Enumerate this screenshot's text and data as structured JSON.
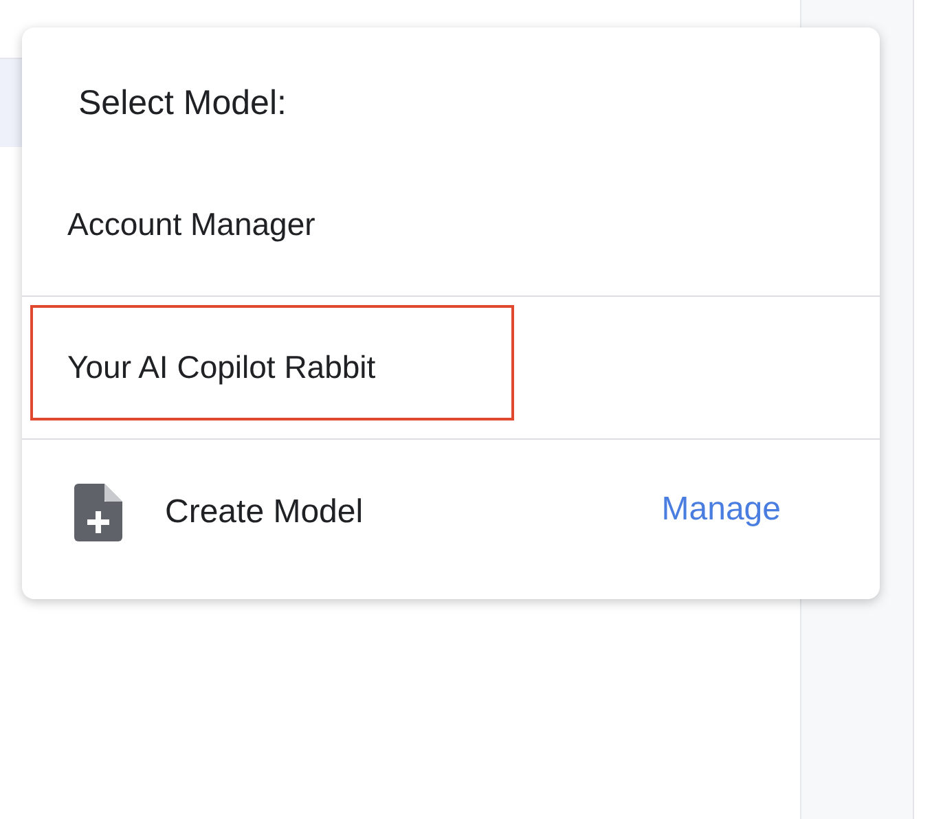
{
  "menu": {
    "title": "Select Model:",
    "models": [
      {
        "name": "Account Manager",
        "highlighted": false
      },
      {
        "name": "Your AI Copilot Rabbit",
        "highlighted": true
      }
    ],
    "create_label": "Create Model",
    "manage_link": "Manage"
  }
}
